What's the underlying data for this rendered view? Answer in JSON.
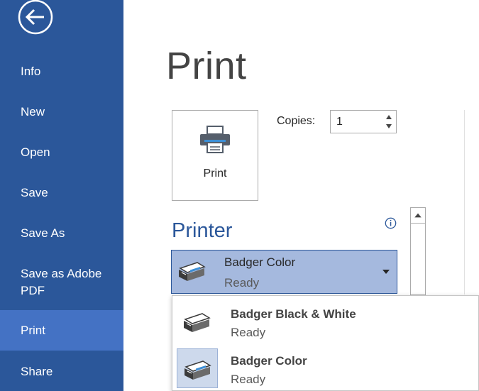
{
  "sidebar": {
    "items": [
      {
        "label": "Info"
      },
      {
        "label": "New"
      },
      {
        "label": "Open"
      },
      {
        "label": "Save"
      },
      {
        "label": "Save As"
      },
      {
        "label": "Save as Adobe PDF"
      },
      {
        "label": "Print"
      },
      {
        "label": "Share"
      }
    ],
    "active_item": "Print"
  },
  "main": {
    "title": "Print",
    "print_button_label": "Print",
    "copies": {
      "label": "Copies:",
      "value": "1"
    },
    "printer_section": {
      "heading": "Printer",
      "selected": {
        "name": "Badger Color",
        "status": "Ready"
      },
      "options": [
        {
          "name": "Badger Black & White",
          "status": "Ready"
        },
        {
          "name": "Badger Color",
          "status": "Ready"
        }
      ]
    }
  },
  "colors": {
    "sidebar_bg": "#2b579a",
    "sidebar_active": "#4472c4",
    "accent": "#2b579a",
    "selected_printer_bg": "#a5b9de"
  },
  "icons": [
    "back-arrow-icon",
    "printer-icon",
    "info-icon",
    "spin-up-icon",
    "spin-down-icon",
    "chevron-down-icon",
    "scroll-up-icon"
  ]
}
